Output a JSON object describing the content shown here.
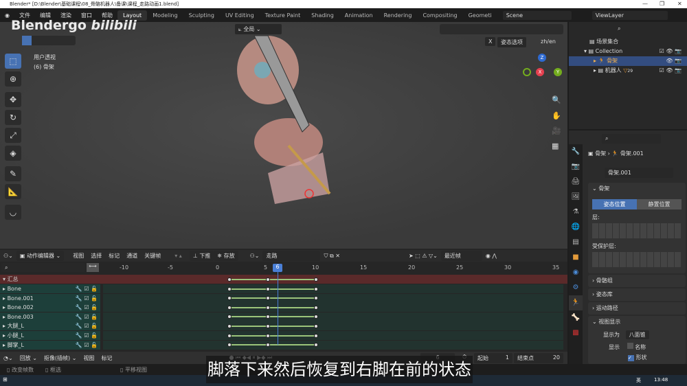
{
  "window": {
    "title": "Blender* [D:\\Blender\\基础课程\\08_骨骼机器人\\备课\\课程_走路动画1.blend]",
    "controls": [
      "—",
      "❐",
      "✕"
    ]
  },
  "menu": {
    "items": [
      "文件",
      "编辑",
      "渲染",
      "窗口",
      "帮助"
    ],
    "workspaces": [
      "Layout",
      "Modeling",
      "Sculpting",
      "UV Editing",
      "Texture Paint",
      "Shading",
      "Animation",
      "Rendering",
      "Compositing",
      "Geometi"
    ],
    "active_workspace": "Layout",
    "scene": "Scene",
    "view_layer": "ViewLayer"
  },
  "watermark": {
    "text": "Blendergo bilibili"
  },
  "viewport": {
    "view_name": "用户透视",
    "object_info": "(6) 骨架",
    "transform_orientation": "全局",
    "pose_options": "姿态选项",
    "lang_toggle": "zh/en",
    "x_mirror": "X",
    "gizmo": {
      "z": "Z",
      "x": "X",
      "y": "Y"
    }
  },
  "outliner": {
    "items": [
      {
        "label": "场景集合"
      },
      {
        "label": "Collection"
      },
      {
        "label": "骨架",
        "selected": true
      },
      {
        "label": "机器人",
        "badge": "29"
      }
    ]
  },
  "properties": {
    "breadcrumb": [
      "骨架",
      "骨架.001"
    ],
    "data_name": "骨架.001",
    "section": "骨架",
    "pose_position": "姿态位置",
    "rest_position": "静置位置",
    "layers_label": "层:",
    "protected_layers_label": "受保护层:",
    "collapsed_panels": [
      "骨骼组",
      "姿态库",
      "运动路径"
    ],
    "viewport_display": "视图显示",
    "display_as_label": "显示为",
    "display_as_value": "八面锥",
    "show_label": "显示",
    "name_option": "名称",
    "shape_option": "形状",
    "shape_checked": true,
    "name_checked": false
  },
  "dopesheet": {
    "mode": "动作编辑器",
    "menus": [
      "视图",
      "选择",
      "标记",
      "通道",
      "关键帧"
    ],
    "push_down": "下推",
    "stash": "存放",
    "action": "走路",
    "snap": "最近帧",
    "ruler": [
      -10,
      -5,
      0,
      5,
      10,
      15,
      20,
      25,
      30,
      35
    ],
    "current_frame": 6,
    "summary": "汇总",
    "channels": [
      "Bone",
      "Bone.001",
      "Bone.002",
      "Bone.003",
      "大腿_L",
      "小腿_L",
      "脚掌_L"
    ],
    "keyframes": [
      1,
      5,
      10
    ]
  },
  "timeline": {
    "menus": [
      "回放",
      "抠像(插帧)",
      "视图",
      "标记"
    ],
    "current_frame": "6",
    "start_label": "起始",
    "start": "1",
    "end_label": "结束点",
    "end": "20"
  },
  "status": {
    "items": [
      "改变帧数",
      "框选",
      "平移视图"
    ],
    "clock": "13:48",
    "ime": "英"
  },
  "subtitle": "脚落下来然后恢复到右脚在前的状态",
  "colors": {
    "accent": "#4772b3",
    "channel": "#1d3f3a",
    "summary": "#5a2a2a",
    "playhead": "#4a7fd6",
    "hold": "#9bc47a"
  }
}
